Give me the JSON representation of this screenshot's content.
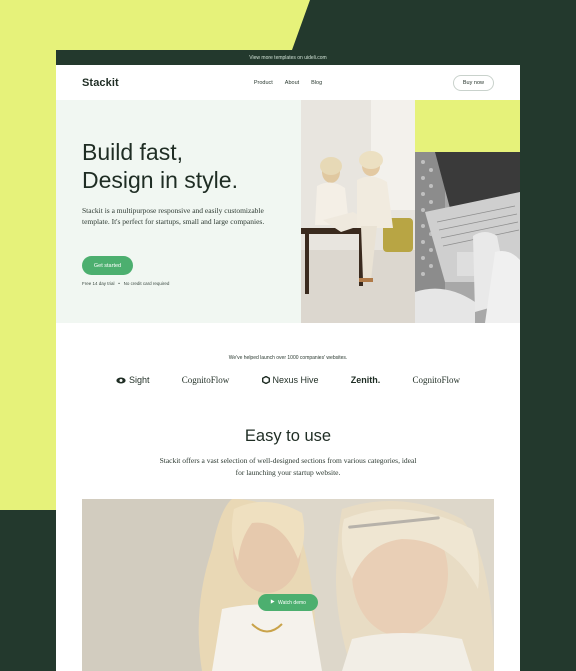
{
  "announcement": "View more templates on uideli.com",
  "nav": {
    "logo": "Stackit",
    "links": [
      "Product",
      "About",
      "Blog"
    ],
    "buy_label": "Buy now"
  },
  "hero": {
    "title_line1": "Build fast,",
    "title_line2": "Design in style.",
    "description": "Stackit is a multipurpose responsive and easily customizable template. It's perfect for startups, small and large companies.",
    "cta_label": "Get started",
    "fine_print_1": "Free 14 day trial",
    "fine_print_2": "No credit card required"
  },
  "trust": {
    "text": "We've helped launch over 1000 companies' websites.",
    "logos": [
      "Sight",
      "CognitoFlow",
      "Nexus Hive",
      "Zenith.",
      "CognitoFlow"
    ]
  },
  "features": {
    "title": "Easy to use",
    "description": "Stackit offers a vast selection of well-designed sections from various categories, ideal for launching your startup website."
  },
  "video": {
    "watch_label": "Watch demo"
  },
  "colors": {
    "dark_green": "#23392d",
    "lime": "#e6f27a",
    "accent_green": "#4caf6f",
    "hero_bg": "#f1f7f2"
  }
}
